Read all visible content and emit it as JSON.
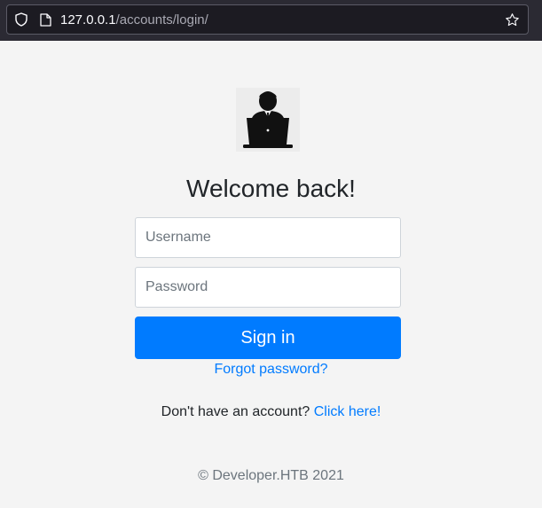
{
  "browser": {
    "url_host": "127.0.0.1",
    "url_path": "/accounts/login/",
    "icons": [
      "shield-icon",
      "page-icon",
      "bookmark-star-icon"
    ]
  },
  "login": {
    "logo_icon": "person-at-laptop-icon",
    "title": "Welcome back!",
    "username_placeholder": "Username",
    "password_placeholder": "Password",
    "signin_label": "Sign in",
    "forgot_label": "Forgot password?",
    "signup_text": "Don't have an account?",
    "signup_link": "Click here!",
    "footer": "© Developer.HTB 2021"
  },
  "colors": {
    "primary": "#007bff",
    "browser_bar": "#2b2a33",
    "page_bg": "#f4f4f4"
  }
}
